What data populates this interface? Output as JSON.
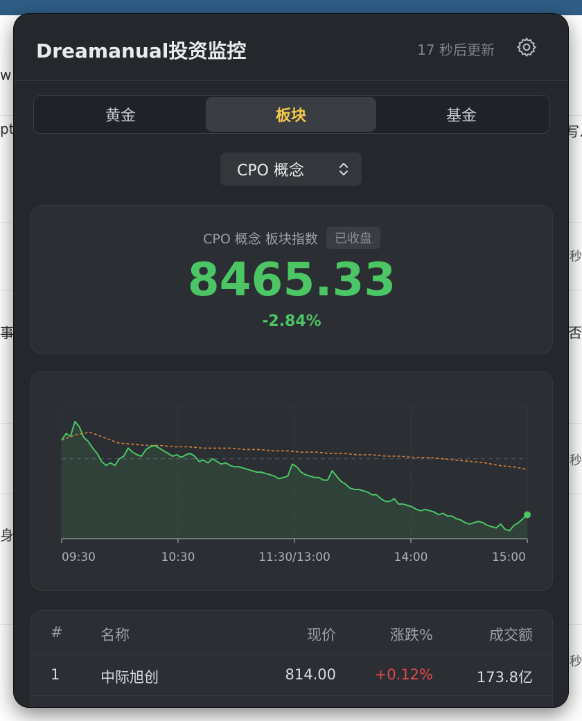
{
  "background": {
    "fragments": [
      "w",
      "pt",
      "写.",
      "秒",
      "事",
      "否",
      "秒",
      "身",
      "秒"
    ]
  },
  "header": {
    "title": "Dreamanual投资监控",
    "countdown": "17 秒后更新"
  },
  "tabs": [
    {
      "label": "黄金",
      "active": false
    },
    {
      "label": "板块",
      "active": true
    },
    {
      "label": "基金",
      "active": false
    }
  ],
  "selector": {
    "value": "CPO 概念"
  },
  "index": {
    "label": "CPO 概念 板块指数",
    "status": "已收盘",
    "value": "8465.33",
    "change": "-2.84%"
  },
  "colors": {
    "down": "#4cc565",
    "up": "#e5484d",
    "accent": "#f2c94c",
    "avg_line": "#d9823b"
  },
  "chart_data": {
    "type": "line",
    "x_ticks": [
      "09:30",
      "10:30",
      "11:30/13:00",
      "14:00",
      "15:00"
    ],
    "ylim": [
      0,
      100
    ],
    "reference_level": 60,
    "series": [
      {
        "role": "price",
        "values": [
          74,
          79,
          77,
          88,
          84,
          76,
          73,
          68,
          64,
          58,
          55,
          57,
          55,
          60,
          62,
          68,
          65,
          63,
          62,
          67,
          69,
          70,
          68,
          66,
          64,
          62,
          63,
          61,
          63,
          64,
          62,
          58,
          59,
          57,
          60,
          58,
          56,
          57,
          55,
          54,
          54,
          53,
          52,
          51,
          50,
          50,
          49,
          48,
          47,
          45,
          46,
          47,
          56,
          54,
          50,
          48,
          47,
          46,
          46,
          44,
          44,
          51,
          47,
          43,
          41,
          38,
          37,
          37,
          36,
          35,
          33,
          33,
          30,
          28,
          28,
          30,
          26,
          26,
          25,
          24,
          22,
          21,
          22,
          21,
          20,
          18,
          19,
          17,
          17,
          15,
          14,
          12,
          11,
          12,
          13,
          12,
          10,
          9,
          8,
          11,
          7,
          6,
          10,
          12,
          15,
          18
        ]
      },
      {
        "role": "average",
        "values": [
          74,
          78,
          80,
          76,
          72,
          71,
          70,
          70,
          69,
          69,
          68,
          68,
          68,
          67,
          67,
          66,
          66,
          65,
          65,
          64,
          64,
          63,
          63,
          62,
          62,
          61,
          61,
          60,
          59,
          58,
          57,
          55,
          54,
          52
        ]
      }
    ]
  },
  "table": {
    "headers": [
      "#",
      "名称",
      "现价",
      "涨跌%",
      "成交额"
    ],
    "rows": [
      [
        "1",
        "中际旭创",
        "814.00",
        "+0.12%",
        "173.8亿"
      ]
    ]
  }
}
